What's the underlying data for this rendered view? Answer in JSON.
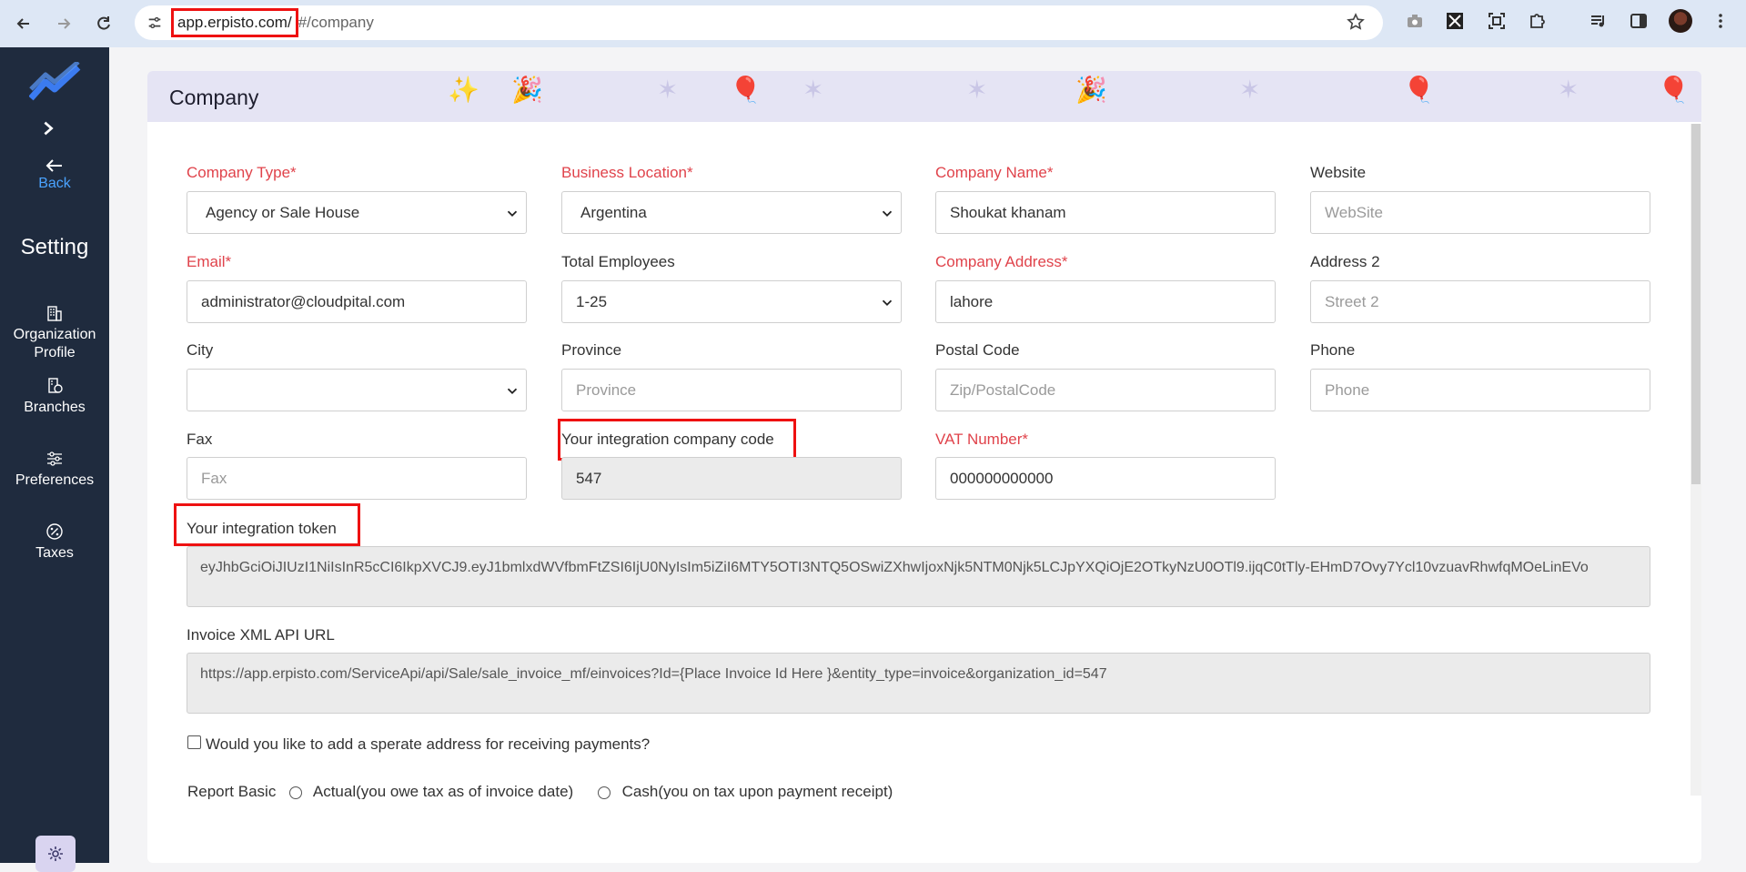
{
  "browser": {
    "url_host": "app.erpisto.com/",
    "url_path": "#/company"
  },
  "sidebar": {
    "back_label": "Back",
    "title": "Setting",
    "items": [
      {
        "label": "Organization Profile",
        "icon": "building-icon"
      },
      {
        "label": "Branches",
        "icon": "branches-icon"
      },
      {
        "label": "Preferences",
        "icon": "sliders-icon"
      },
      {
        "label": "Taxes",
        "icon": "percent-icon"
      }
    ]
  },
  "page": {
    "title": "Company"
  },
  "form": {
    "company_type": {
      "label": "Company Type*",
      "value": "Agency or Sale House"
    },
    "business_location": {
      "label": "Business Location*",
      "value": "Argentina"
    },
    "company_name": {
      "label": "Company Name*",
      "value": "Shoukat khanam"
    },
    "website": {
      "label": "Website",
      "placeholder": "WebSite"
    },
    "email": {
      "label": "Email*",
      "value": "administrator@cloudpital.com"
    },
    "total_employees": {
      "label": "Total Employees",
      "value": "1-25"
    },
    "company_address": {
      "label": "Company Address*",
      "value": "lahore"
    },
    "address2": {
      "label": "Address 2",
      "placeholder": "Street 2"
    },
    "city": {
      "label": "City",
      "value": ""
    },
    "province": {
      "label": "Province",
      "placeholder": "Province"
    },
    "postal_code": {
      "label": "Postal Code",
      "placeholder": "Zip/PostalCode"
    },
    "phone": {
      "label": "Phone",
      "placeholder": "Phone"
    },
    "fax": {
      "label": "Fax",
      "placeholder": "Fax"
    },
    "integration_code": {
      "label": "Your integration company code",
      "value": "547"
    },
    "vat_number": {
      "label": "VAT Number*",
      "value": "000000000000"
    },
    "integration_token": {
      "label": "Your integration token",
      "value": "eyJhbGciOiJIUzI1NiIsInR5cCI6IkpXVCJ9.eyJ1bmlxdWVfbmFtZSI6IjU0NyIsIm5iZiI6MTY5OTI3NTQ5OSwiZXhwIjoxNjk5NTM0Njk5LCJpYXQiOjE2OTkyNzU0OTl9.ijqC0tTly-EHmD7Ovy7Ycl10vzuavRhwfqMOeLinEVo"
    },
    "invoice_xml_url": {
      "label": "Invoice XML API URL",
      "value": "https://app.erpisto.com/ServiceApi/api/Sale/sale_invoice_mf/einvoices?Id={Place Invoice Id Here }&entity_type=invoice&organization_id=547"
    },
    "separate_address": {
      "label": "Would you like to add a sperate address for receiving payments?"
    },
    "report_basis": {
      "label": "Report Basic",
      "option1": "Actual(you owe tax as of invoice date)",
      "option2": "Cash(you on tax upon payment receipt)"
    }
  }
}
